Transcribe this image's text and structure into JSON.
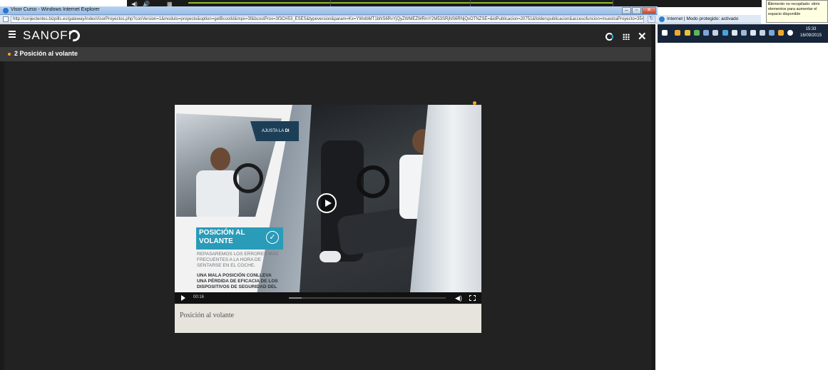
{
  "browser": {
    "title": "Visor Curso - Windows Internet Explorer",
    "address": "http://conjectentes.bizpills.es/gateway/indexVisorProyectos.php?conVersion=1&modulo=proyecto&option=getBcostId&mpx=3f&bcostProx=3f3CH53_ESES&typeversion&param=Kx=YWxlbMT1bNS6RvYjQyZWMEZWRmY2M53SRjNS6RNjQxOTNZSE=&idPublicacion=20751&folderspublicacion&accesofuncion=muestraProyecto=3545&culture=es-ES",
    "zone_status": "Internet | Modo protegido: activado"
  },
  "app": {
    "logo_text": "SANOFI",
    "lesson_title": "2 Posición al volante"
  },
  "video": {
    "tag_text_prefix": "AJUSTA LA ",
    "tag_text_bold": "DI",
    "heading": "POSICIÓN AL VOLANTE",
    "desc_light": "REPASAREMOS LOS ERRORES MÁS FRECUENTES A LA HORA DE SENTARSE EN EL COCHE.",
    "desc_bold": "UNA MALA POSICIÓN CONLLEVA UNA PÉRDIDA DE EFICACIA DE LOS DISPOSITIVOS DE SEGURIDAD DEL",
    "time": "00:16",
    "progress": 0.08
  },
  "caption": "Posición al volante",
  "system": {
    "clock_time": "15:33",
    "clock_date": "16/09/2015",
    "notice": "Elemento no recopilado: elimi elementos para aumentar el espacio disponible"
  }
}
